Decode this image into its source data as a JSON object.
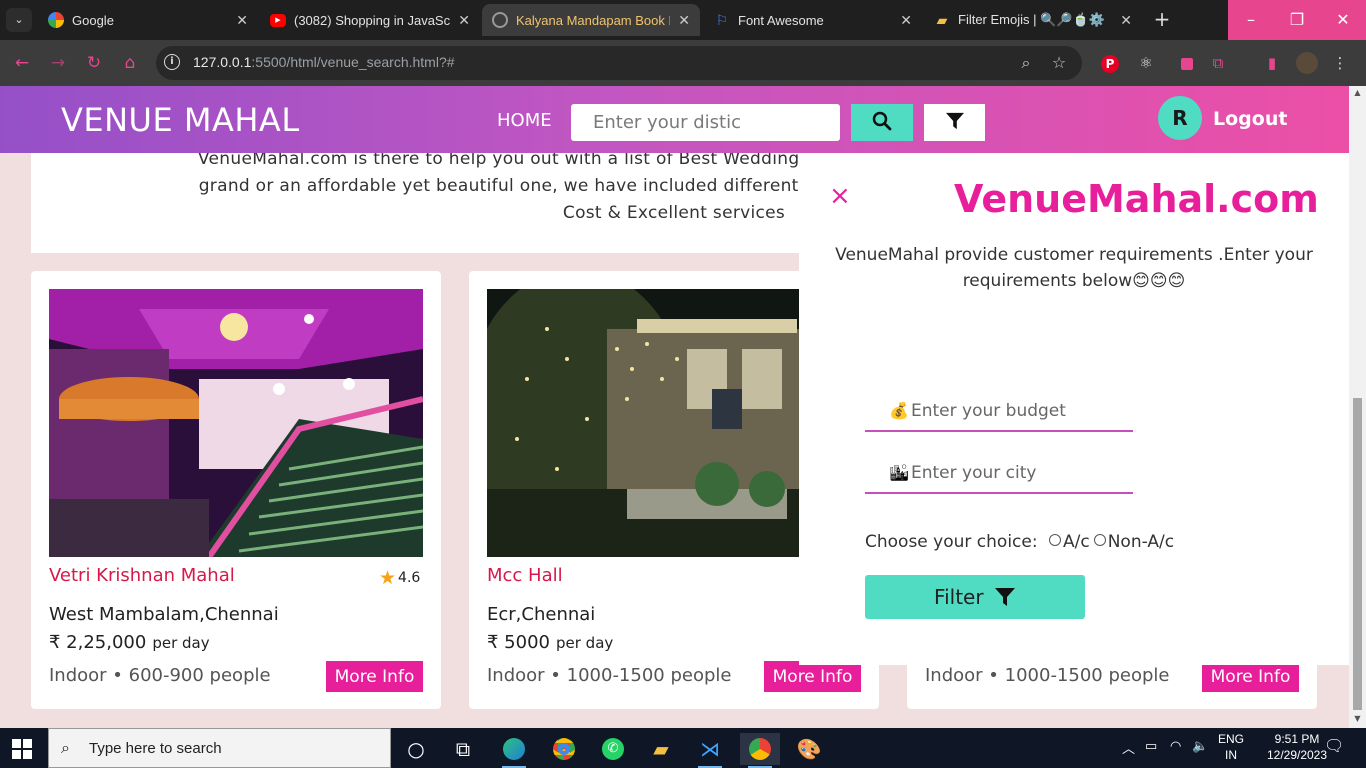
{
  "browser": {
    "tabs": [
      {
        "title": "Google",
        "icon": "google-icon"
      },
      {
        "title": "(3082) Shopping in JavaScript",
        "icon": "youtube-icon"
      },
      {
        "title": "Kalyana Mandapam Book M",
        "icon": "globe-icon",
        "active": true
      },
      {
        "title": "Font Awesome",
        "icon": "flag-icon"
      },
      {
        "title": "Filter Emojis | 🔍🔎🍵⚙️",
        "icon": "folder-icon"
      }
    ],
    "url_host": "127.0.0.1",
    "url_rest": ":5500/html/venue_search.html?#",
    "accent_color": "#e8458f"
  },
  "header": {
    "brand": "VENUE MAHAL",
    "home": "HOME",
    "search_placeholder": "Enter your distic",
    "avatar_initial": "R",
    "logout": "Logout"
  },
  "intro": {
    "line1": "VenueMahal.com is there to help you out with a list of Best Wedding Venues in Che",
    "line2": "grand or an affordable yet beautiful one, we have included different kinds of Weddi",
    "line3": "Cost & Excellent services"
  },
  "venues": [
    {
      "name": "Vetri Krishnan Mahal",
      "rating": "4.6",
      "location": "West Mambalam,Chennai",
      "price": "₹ 2,25,000",
      "per_day": "per day",
      "meta": "Indoor • 600-900 people",
      "button": "More Info"
    },
    {
      "name": "Mcc Hall",
      "location": "Ecr,Chennai",
      "price": "₹ 5000",
      "per_day": "per day",
      "meta": "Indoor • 1000-1500 people",
      "button": "More Info"
    },
    {
      "meta": "Indoor • 1000-1500 people",
      "button": "More Info"
    }
  ],
  "filter_panel": {
    "close": "×",
    "title": "VenueMahal.com",
    "description": "VenueMahal provide customer requirements .Enter your requirements below😊😊😊",
    "budget_placeholder": "Enter your budget",
    "city_placeholder": "Enter your city",
    "choice_label": "Choose your choice:",
    "option_ac": "A/c",
    "option_nonac": "Non-A/c",
    "submit": "Filter"
  },
  "taskbar": {
    "search_placeholder": "Type here to search",
    "lang_top": "ENG",
    "lang_bottom": "IN",
    "time": "9:51 PM",
    "date": "12/29/2023"
  },
  "colors": {
    "brand_pink": "#e81f9b",
    "teal": "#4fdcc2",
    "venue_name": "#d6184a"
  }
}
